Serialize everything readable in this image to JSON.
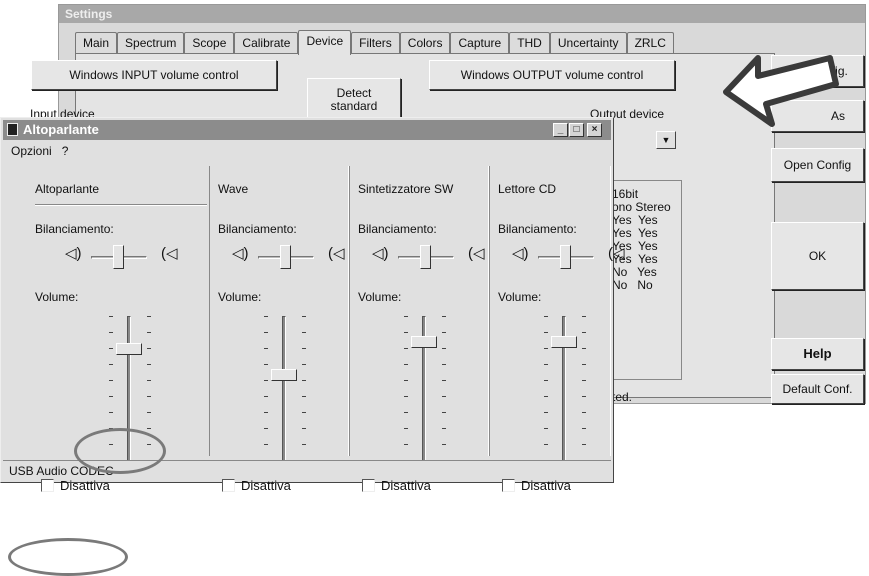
{
  "settings_window": {
    "title": "Settings",
    "tabs": [
      "Main",
      "Spectrum",
      "Scope",
      "Calibrate",
      "Device",
      "Filters",
      "Colors",
      "Capture",
      "THD",
      "Uncertainty",
      "ZRLC"
    ],
    "active_tab": "Device",
    "input_volume_button": "Windows INPUT volume control",
    "output_volume_button": "Windows OUTPUT volume control",
    "detect_button": "Detect\nstandard",
    "input_device_label": "Input device",
    "output_device_label": "Output device",
    "format_lines": [
      "16bit",
      "ono Stereo",
      "Yes  Yes",
      "Yes  Yes",
      "Yes  Yes",
      "Yes  Yes",
      "No   Yes",
      "No   No"
    ],
    "status_text": "ted.",
    "right_buttons": {
      "save_config": "ave Config.",
      "save_as": "As",
      "open_config": "Open Config",
      "ok": "OK",
      "help": "Help",
      "default_conf": "Default Conf."
    }
  },
  "mixer_window": {
    "title": "Altoparlante",
    "window_controls": [
      "_",
      "□",
      "×"
    ],
    "menu": [
      "Opzioni",
      "?"
    ],
    "balance_label": "Bilanciamento:",
    "volume_label": "Volume:",
    "mute_label": "Disattiva",
    "channels": [
      {
        "name": "Altoparlante",
        "volume": 0.8,
        "muted": false
      },
      {
        "name": "Wave",
        "volume": 0.6,
        "muted": false
      },
      {
        "name": "Sintetizzatore SW",
        "volume": 0.85,
        "muted": false
      },
      {
        "name": "Lettore CD",
        "volume": 0.85,
        "muted": false
      }
    ],
    "status_bar": "USB Audio CODEC"
  },
  "icons": {
    "speaker_left": "speaker-left-icon",
    "speaker_right": "speaker-right-icon",
    "arrow": "pointer-arrow-icon"
  },
  "colors": {
    "window_face": "#e0e0e0",
    "titlebar": "#8c8c8c",
    "annotation_circle": "#7a7a7a"
  }
}
